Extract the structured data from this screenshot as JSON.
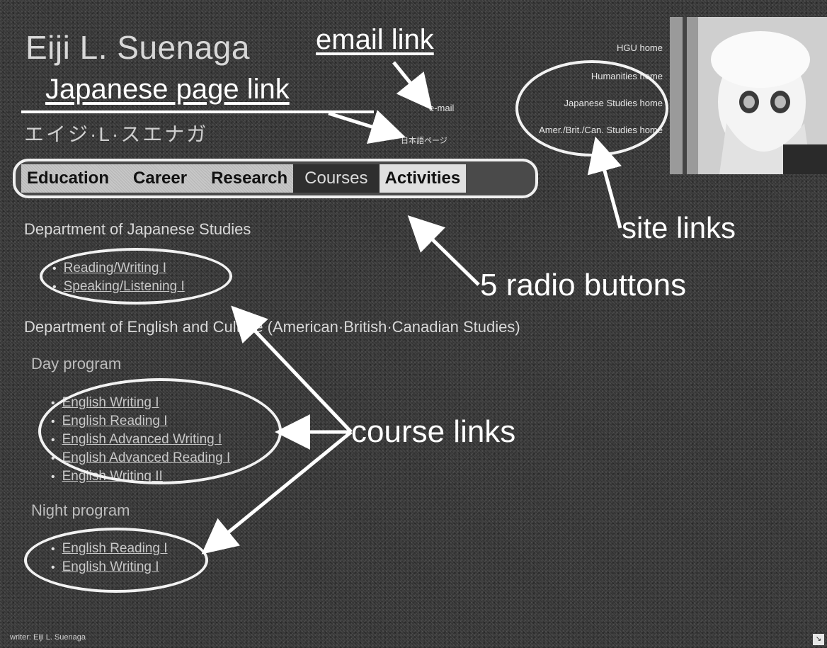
{
  "header": {
    "title": "Eiji L. Suenaga",
    "title_jp": "エイジ·L·スエナガ",
    "email_link": "e-mail",
    "japanese_page_link": "日本語ページ"
  },
  "site_links": [
    {
      "label": "HGU home"
    },
    {
      "label": "Humanities home"
    },
    {
      "label": "Japanese Studies home"
    },
    {
      "label": "Amer./Brit./Can. Studies home"
    }
  ],
  "nav": {
    "buttons": [
      {
        "label": "Education"
      },
      {
        "label": "Career"
      },
      {
        "label": "Research"
      },
      {
        "label": "Courses"
      },
      {
        "label": "Activities"
      }
    ]
  },
  "main": {
    "dept_japanese": "Department of Japanese Studies",
    "japanese_courses": [
      "Reading/Writing I",
      "Speaking/Listening I"
    ],
    "dept_english": "Department of English and Culture (American·British·Canadian Studies)",
    "day_program": "Day program",
    "day_courses": [
      "English Writing I",
      "English Reading I",
      "English Advanced Writing I",
      "English Advanced Reading I",
      "English Writing II"
    ],
    "night_program": "Night program",
    "night_courses": [
      "English Reading I",
      "English Writing I"
    ]
  },
  "footer": {
    "writer": "writer: Eiji L. Suenaga"
  },
  "annotations": {
    "email_link": "email link",
    "japanese_page_link": "Japanese page link",
    "site_links": "site links",
    "radio_buttons": "5 radio buttons",
    "course_links": "course links"
  },
  "icons": {
    "portrait": "portrait-photo",
    "corner": "resize-corner-icon"
  }
}
